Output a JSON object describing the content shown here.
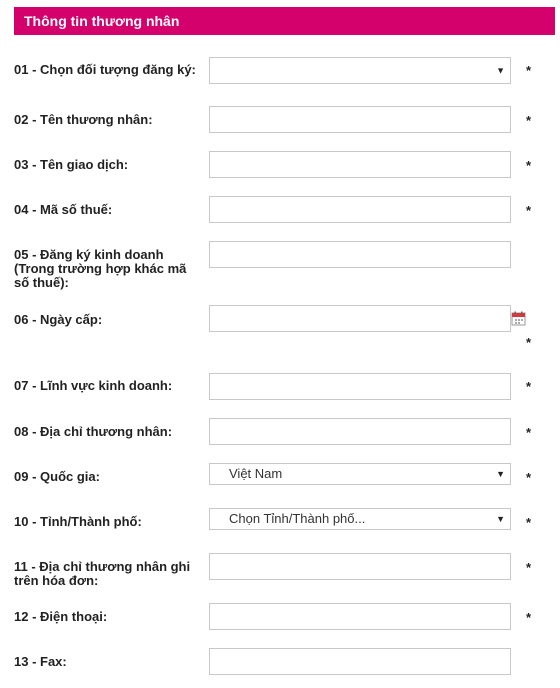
{
  "section_title": "Thông tin thương nhân",
  "required_mark": "*",
  "fields": {
    "f01": {
      "label": "01 - Chọn đối tượng đăng ký:",
      "value": ""
    },
    "f02": {
      "label": "02 - Tên thương nhân:",
      "value": ""
    },
    "f03": {
      "label": "03 - Tên giao dịch:",
      "value": ""
    },
    "f04": {
      "label": "04 - Mã số thuế:",
      "value": ""
    },
    "f05": {
      "label": "05 - Đăng ký kinh doanh (Trong trường hợp khác mã số thuế):",
      "value": ""
    },
    "f06": {
      "label": "06 - Ngày cấp:",
      "value": ""
    },
    "f07": {
      "label": "07 - Lĩnh vực kinh doanh:",
      "value": ""
    },
    "f08": {
      "label": "08 - Địa chỉ thương nhân:",
      "value": ""
    },
    "f09": {
      "label": "09 - Quốc gia:",
      "value": "Việt Nam"
    },
    "f10": {
      "label": "10 - Tỉnh/Thành phố:",
      "value": "Chọn Tỉnh/Thành phố..."
    },
    "f11": {
      "label": "11 - Địa chỉ thương nhân ghi trên hóa đơn:",
      "value": ""
    },
    "f12": {
      "label": "12 - Điện thoại:",
      "value": ""
    },
    "f13": {
      "label": "13 - Fax:",
      "value": ""
    }
  },
  "icons": {
    "dropdown": "chevron-down-icon",
    "calendar": "calendar-icon"
  },
  "colors": {
    "header_bg": "#d4006b",
    "header_text": "#ffffff",
    "border": "#c8c8c8"
  }
}
